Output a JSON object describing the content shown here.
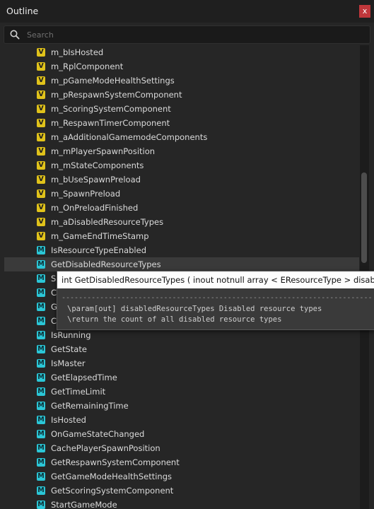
{
  "window": {
    "title": "Outline",
    "close_label": "x"
  },
  "search": {
    "placeholder": "Search"
  },
  "colors": {
    "variable_badge": "#e0c21a",
    "method_badge": "#2bc6d6",
    "close": "#c0373b"
  },
  "icons": {
    "search": "search-icon",
    "variable": "V",
    "method": "M"
  },
  "tree": {
    "items": [
      {
        "kind": "V",
        "label": "m_bIsHosted"
      },
      {
        "kind": "V",
        "label": "m_RplComponent"
      },
      {
        "kind": "V",
        "label": "m_pGameModeHealthSettings"
      },
      {
        "kind": "V",
        "label": "m_pRespawnSystemComponent"
      },
      {
        "kind": "V",
        "label": "m_ScoringSystemComponent"
      },
      {
        "kind": "V",
        "label": "m_RespawnTimerComponent"
      },
      {
        "kind": "V",
        "label": "m_aAdditionalGamemodeComponents"
      },
      {
        "kind": "V",
        "label": "m_mPlayerSpawnPosition"
      },
      {
        "kind": "V",
        "label": "m_mStateComponents"
      },
      {
        "kind": "V",
        "label": "m_bUseSpawnPreload"
      },
      {
        "kind": "V",
        "label": "m_SpawnPreload"
      },
      {
        "kind": "V",
        "label": "m_OnPreloadFinished"
      },
      {
        "kind": "V",
        "label": "m_aDisabledResourceTypes"
      },
      {
        "kind": "V",
        "label": "m_GameEndTimeStamp"
      },
      {
        "kind": "M",
        "label": "IsResourceTypeEnabled"
      },
      {
        "kind": "M",
        "label": "GetDisabledResourceTypes",
        "highlighted": true
      },
      {
        "kind": "M",
        "label": "S"
      },
      {
        "kind": "M",
        "label": "C"
      },
      {
        "kind": "M",
        "label": "G"
      },
      {
        "kind": "M",
        "label": "C"
      },
      {
        "kind": "M",
        "label": "IsRunning"
      },
      {
        "kind": "M",
        "label": "GetState"
      },
      {
        "kind": "M",
        "label": "IsMaster"
      },
      {
        "kind": "M",
        "label": "GetElapsedTime"
      },
      {
        "kind": "M",
        "label": "GetTimeLimit"
      },
      {
        "kind": "M",
        "label": "GetRemainingTime"
      },
      {
        "kind": "M",
        "label": "IsHosted"
      },
      {
        "kind": "M",
        "label": "OnGameStateChanged"
      },
      {
        "kind": "M",
        "label": "CachePlayerSpawnPosition"
      },
      {
        "kind": "M",
        "label": "GetRespawnSystemComponent"
      },
      {
        "kind": "M",
        "label": "GetGameModeHealthSettings"
      },
      {
        "kind": "M",
        "label": "GetScoringSystemComponent"
      },
      {
        "kind": "M",
        "label": "StartGameMode"
      }
    ]
  },
  "tooltip": {
    "signature": "int GetDisabledResourceTypes ( inout notnull array < EResourceType > disabledR",
    "separator": "--------------------------------------------------------------------------------",
    "lines": [
      "\\param[out] disabledResourceTypes Disabled resource types",
      "\\return the count of all disabled resource types"
    ]
  }
}
